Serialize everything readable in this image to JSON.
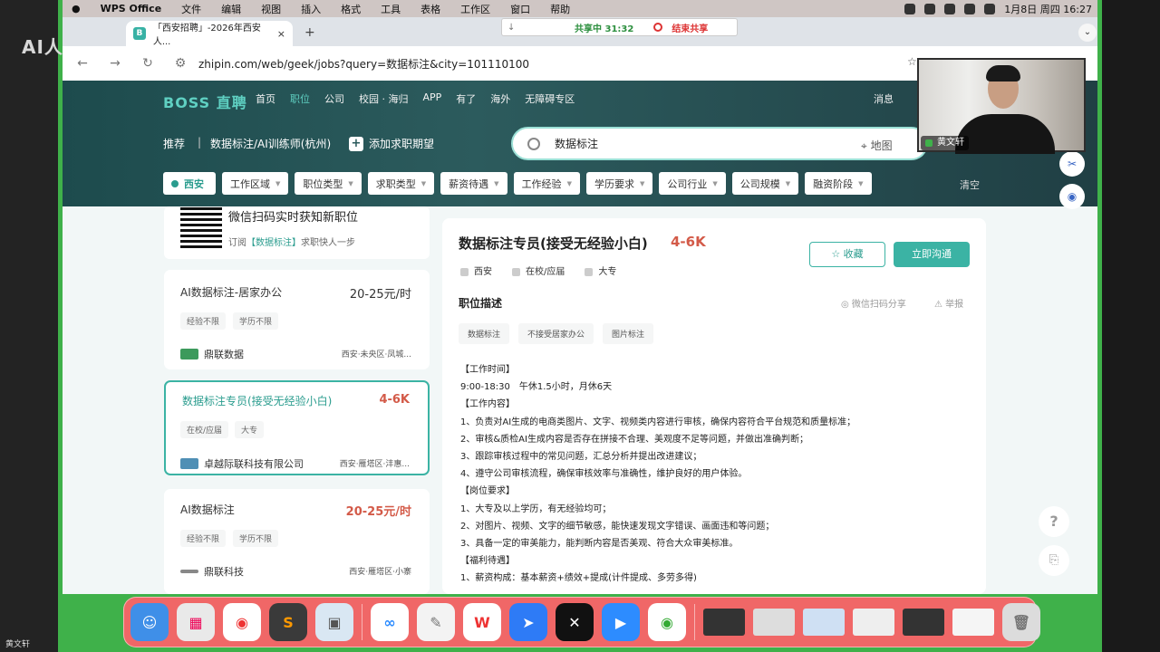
{
  "overlay": {
    "logo_text": "AI人",
    "bottom_name": "黄文轩"
  },
  "menubar": {
    "app": "WPS Office",
    "items": [
      "文件",
      "编辑",
      "视图",
      "插入",
      "格式",
      "工具",
      "表格",
      "工作区",
      "窗口",
      "帮助"
    ],
    "date_time": "1月8日 周四 16:27"
  },
  "browser": {
    "tab_title": "「西安招聘」-2026年西安人...",
    "tab_favicon": "B",
    "close": "×",
    "new_tab": "+",
    "url": "zhipin.com/web/geek/jobs?query=数据标注&city=101110100",
    "share": {
      "status": "共享中 31:32",
      "end_label": "结束共享"
    }
  },
  "boss": {
    "logo": "BOSS 直聘",
    "nav": [
      "首页",
      "职位",
      "公司",
      "校园 · 海归",
      "APP",
      "有了",
      "海外",
      "无障碍专区"
    ],
    "active_nav": "职位",
    "right_nav": "消息",
    "rec_label": "推荐",
    "rec_sep": "|",
    "rec_job": "数据标注/AI训练师(杭州)",
    "add_intent": "添加求职期望",
    "search_value": "数据标注",
    "map_label": "地图",
    "filters": [
      "西安",
      "工作区域",
      "职位类型",
      "求职类型",
      "薪资待遇",
      "工作经验",
      "学历要求",
      "公司行业",
      "公司规模",
      "融资阶段"
    ],
    "clear_label": "清空"
  },
  "qr": {
    "title": "微信扫码实时获知新职位",
    "sub_prefix": "订阅",
    "keyword": "【数据标注】",
    "sub_suffix": "求职快人一步"
  },
  "jobs": [
    {
      "title": "AI数据标注-居家办公",
      "salary": "20-25元/时",
      "tags": [
        "经验不限",
        "学历不限"
      ],
      "company": "鼎联数据",
      "location": "西安·未央区·凤城..."
    },
    {
      "title": "数据标注专员(接受无经验小白)",
      "salary": "4-6K",
      "tags": [
        "在校/应届",
        "大专"
      ],
      "company": "卓越际联科技有限公司",
      "location": "西安·雁塔区·沣惠..."
    },
    {
      "title": "AI数据标注",
      "salary": "20-25元/时",
      "tags": [
        "经验不限",
        "学历不限"
      ],
      "company": "鼎联科技",
      "location": "西安·雁塔区·小寨"
    }
  ],
  "detail": {
    "title": "数据标注专员(接受无经验小白)",
    "salary": "4-6K",
    "meta": [
      "西安",
      "在校/应届",
      "大专"
    ],
    "fav_label": "收藏",
    "chat_label": "立即沟通",
    "section": "职位描述",
    "share_label": "微信扫码分享",
    "report_label": "举报",
    "tags": [
      "数据标注",
      "不接受居家办公",
      "图片标注"
    ],
    "body": [
      "【工作时间】",
      "9:00-18:30　午休1.5小时，月休6天",
      "【工作内容】",
      "1、负责对AI生成的电商类图片、文字、视频类内容进行审核，确保内容符合平台规范和质量标准；",
      "2、审核&质检AI生成内容是否存在拼接不合理、美观度不足等问题，并做出准确判断；",
      "3、跟踪审核过程中的常见问题，汇总分析并提出改进建议；",
      "4、遵守公司审核流程，确保审核效率与准确性，维护良好的用户体验。",
      "【岗位要求】",
      "1、大专及以上学历，有无经验均可；",
      "2、对图片、视频、文字的细节敏感，能快速发现文字错误、画面违和等问题；",
      "3、具备一定的审美能力，能判断内容是否美观、符合大众审美标准。",
      "【福利待遇】",
      "1、薪资构成：基本薪资+绩效+提成(计件提成、多劳多得)"
    ]
  },
  "webcam": {
    "name": "黄文轩"
  },
  "side": {
    "help": "?",
    "clip": "⎘",
    "tool1": "✂",
    "tool2": "◉"
  },
  "dock": {
    "apps": [
      "finder",
      "launchpad",
      "chrome",
      "sublime",
      "preview",
      "baidu-netdisk",
      "textedit",
      "wps",
      "feishu",
      "capcut",
      "zoom",
      "chrome-2"
    ],
    "colors": [
      "#3f8fe8",
      "#e9e9e9",
      "#ffffff",
      "#3a3a3a",
      "#d9e7f3",
      "#ffffff",
      "#f3f3f3",
      "#ffffff",
      "#2e7bf6",
      "#111111",
      "#2d8cff",
      "#ffffff"
    ]
  }
}
